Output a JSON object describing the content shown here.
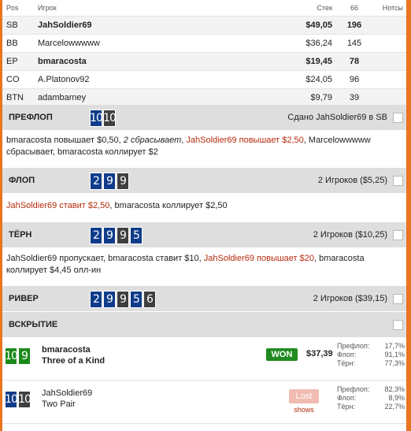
{
  "table": {
    "headers": {
      "pos": "Pos",
      "player": "Игрок",
      "stack": "Стек",
      "count": "66",
      "notes": "Нотсы"
    },
    "rows": [
      {
        "pos": "SB",
        "player": "JahSoldier69",
        "stack": "$49,05",
        "count": "196"
      },
      {
        "pos": "BB",
        "player": "Marcelowwwww",
        "stack": "$36,24",
        "count": "145"
      },
      {
        "pos": "EP",
        "player": "bmaracosta",
        "stack": "$19,45",
        "count": "78"
      },
      {
        "pos": "CO",
        "player": "A.Platonov92",
        "stack": "$24,05",
        "count": "96"
      },
      {
        "pos": "BTN",
        "player": "adambarney",
        "stack": "$9,79",
        "count": "39"
      }
    ]
  },
  "preflop": {
    "title": "ПРЕФЛОП",
    "cards": [
      "10",
      "10"
    ],
    "info": "Сдано JahSoldier69 в SB",
    "actions": [
      "bmaracosta повышает $0,50, ",
      "2 сбрасывает",
      ", ",
      "JahSoldier69 повышает $2,50",
      ", Marcelowwwww сбрасывает, bmaracosta коллирует $2"
    ]
  },
  "flop": {
    "title": "ФЛОП",
    "cards": [
      "2",
      "9",
      "9"
    ],
    "info": "2 Игроков ($5,25)",
    "actions": [
      "JahSoldier69 ставит $2,50",
      ", bmaracosta коллирует $2,50"
    ]
  },
  "turn": {
    "title": "ТЁРН",
    "cards": [
      "2",
      "9",
      "9",
      "5"
    ],
    "info": "2 Игроков ($10,25)",
    "actions": [
      "JahSoldier69 пропускает, bmaracosta ставит $10, ",
      "JahSoldier69 повышает $20",
      ", bmaracosta коллирует $4,45 олл-ин"
    ]
  },
  "river": {
    "title": "РИВЕР",
    "cards": [
      "2",
      "9",
      "9",
      "5",
      "6"
    ],
    "info": "2 Игроков ($39,15)"
  },
  "showdown": {
    "title": "ВСКРЫТИЕ",
    "players": [
      {
        "cards": [
          "10",
          "9"
        ],
        "name": "bmaracosta",
        "hand": "Three of a Kind",
        "result": "WON",
        "amount": "$37,39",
        "equity": [
          {
            "label": "Префлоп:",
            "value": "17,7%"
          },
          {
            "label": "Флоп:",
            "value": "91,1%"
          },
          {
            "label": "Тёрн:",
            "value": "77,3%"
          }
        ]
      },
      {
        "cards": [
          "10",
          "10"
        ],
        "name": "JahSoldier69",
        "hand": "Two Pair",
        "result": "Lost",
        "shows": "shows",
        "equity": [
          {
            "label": "Префлоп:",
            "value": "82,3%"
          },
          {
            "label": "Флоп:",
            "value": "8,9%"
          },
          {
            "label": "Тёрн:",
            "value": "22,7%"
          }
        ]
      }
    ]
  },
  "colors": {
    "frame": "#e8761e",
    "hero_action": "#b52a0d",
    "won": "#1f8a1f",
    "lost": "#f0bcb2",
    "card_blue": "#0f3c8a",
    "card_green": "#1b8a1b"
  }
}
